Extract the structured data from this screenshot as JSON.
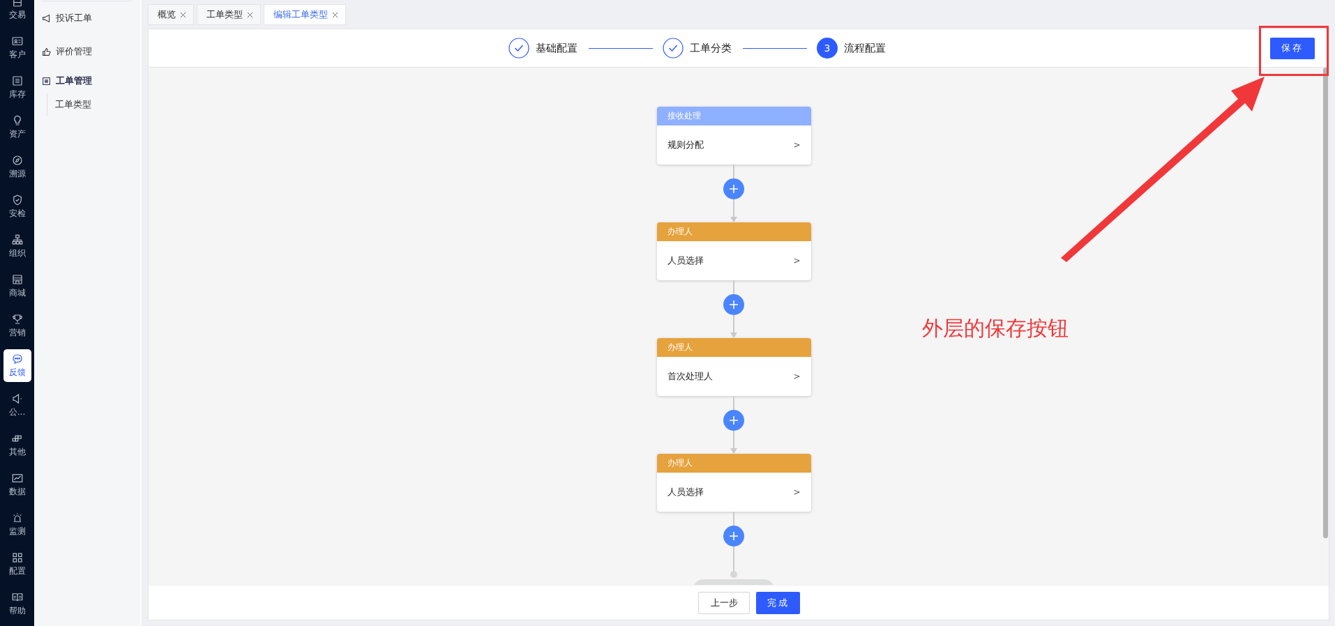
{
  "nav": {
    "items": [
      {
        "label": "交易",
        "selected": false
      },
      {
        "label": "客户",
        "selected": false
      },
      {
        "label": "库存",
        "selected": false
      },
      {
        "label": "资产",
        "selected": false
      },
      {
        "label": "溯源",
        "selected": false
      },
      {
        "label": "安检",
        "selected": false
      },
      {
        "label": "组织",
        "selected": false
      },
      {
        "label": "商城",
        "selected": false
      },
      {
        "label": "营销",
        "selected": false
      },
      {
        "label": "反馈",
        "selected": true
      },
      {
        "label": "公...",
        "selected": false
      },
      {
        "label": "其他",
        "selected": false
      },
      {
        "label": "数据",
        "selected": false
      },
      {
        "label": "监测",
        "selected": false
      },
      {
        "label": "配置",
        "selected": false
      },
      {
        "label": "帮助",
        "selected": false
      }
    ]
  },
  "sidebar": {
    "items": [
      {
        "label": "投诉工单",
        "expanded": false
      },
      {
        "label": "评价管理",
        "expanded": false
      },
      {
        "label": "工单管理",
        "expanded": true,
        "children": [
          {
            "label": "工单类型"
          }
        ]
      }
    ]
  },
  "tabs": [
    {
      "label": "概览",
      "selected": false
    },
    {
      "label": "工单类型",
      "selected": false
    },
    {
      "label": "编辑工单类型",
      "selected": true
    }
  ],
  "steps": [
    {
      "label": "基础配置",
      "kind": "done"
    },
    {
      "label": "工单分类",
      "kind": "done"
    },
    {
      "label": "流程配置",
      "kind": "current",
      "number": "3"
    }
  ],
  "save_button": "保存",
  "flow": {
    "nodes": [
      {
        "header": "接收处理",
        "body": "规则分配",
        "action": ">",
        "color": "#8fb0ff"
      },
      {
        "header": "办理人",
        "body": "人员选择",
        "action": ">",
        "color": "#e6a23c"
      },
      {
        "header": "办理人",
        "body": "首次处理人",
        "action": ">",
        "color": "#e6a23c"
      },
      {
        "header": "办理人",
        "body": "人员选择",
        "action": ">",
        "color": "#e6a23c"
      }
    ]
  },
  "footer": {
    "prev_button": "上一步",
    "finish_button": "完成"
  },
  "annotation": {
    "text": "外层的保存按钮"
  }
}
